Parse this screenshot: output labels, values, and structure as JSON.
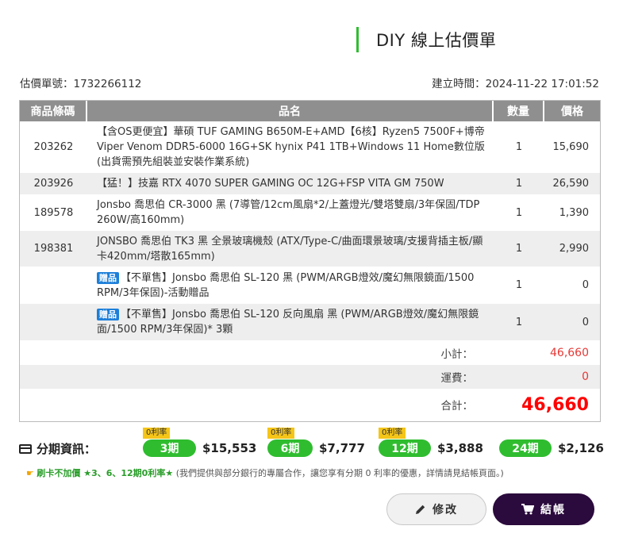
{
  "header": {
    "title": "DIY 線上估價單",
    "accent_color": "#2fbd2f"
  },
  "meta": {
    "quote_no_label": "估價單號：",
    "quote_no": "1732266112",
    "created_label": "建立時間：",
    "created_at": "2024-11-22 17:01:52"
  },
  "table": {
    "columns": [
      "商品條碼",
      "品名",
      "數量",
      "價格"
    ],
    "rows": [
      {
        "code": "203262",
        "gift": "",
        "name": "【含OS更便宜】華碩 TUF GAMING B650M-E+AMD【6核】Ryzen5 7500F+博帝 Viper Venom DDR5-6000 16G+SK hynix P41 1TB+Windows 11 Home數位版(出貨需預先組裝並安裝作業系統)",
        "qty": "1",
        "price": "15,690"
      },
      {
        "code": "203926",
        "gift": "",
        "name": "【猛！】技嘉 RTX 4070 SUPER GAMING OC 12G+FSP VITA GM 750W",
        "qty": "1",
        "price": "26,590"
      },
      {
        "code": "189578",
        "gift": "",
        "name": "Jonsbo 喬思伯 CR-3000 黑 (7導管/12cm風扇*2/上蓋燈光/雙塔雙扇/3年保固/TDP 260W/高160mm)",
        "qty": "1",
        "price": "1,390"
      },
      {
        "code": "198381",
        "gift": "",
        "name": "JONSBO 喬思伯 TK3 黑 全景玻璃機殼 (ATX/Type-C/曲面環景玻璃/支援背插主板/顯卡420mm/塔散165mm)",
        "qty": "1",
        "price": "2,990"
      },
      {
        "code": "",
        "gift": "贈品",
        "name": "【不單售】Jonsbo 喬思伯 SL-120 黑 (PWM/ARGB燈效/魔幻無限鏡面/1500 RPM/3年保固)-活動贈品",
        "qty": "1",
        "price": "0"
      },
      {
        "code": "",
        "gift": "贈品",
        "name": "【不單售】Jonsbo 喬思伯 SL-120 反向風扇 黑 (PWM/ARGB燈效/魔幻無限鏡面/1500 RPM/3年保固)* 3顆",
        "qty": "1",
        "price": "0"
      }
    ]
  },
  "summary": {
    "subtotal_label": "小計：",
    "subtotal": "46,660",
    "shipping_label": "運費：",
    "shipping": "0",
    "total_label": "合計：",
    "total": "46,660"
  },
  "installment": {
    "label": "分期資訊：",
    "plans": [
      {
        "tag": "0利率",
        "period": "3期",
        "amount": "$15,553"
      },
      {
        "tag": "0利率",
        "period": "6期",
        "amount": "$7,777"
      },
      {
        "tag": "0利率",
        "period": "12期",
        "amount": "$3,888"
      },
      {
        "tag": "",
        "period": "24期",
        "amount": "$2,126"
      }
    ],
    "note_highlight": "刷卡不加價 ★3、6、12期0利率★",
    "note_rest": "(我們提供與部分銀行的專屬合作，讓您享有分期 0 利率的優惠，詳情請見結帳頁面。)"
  },
  "buttons": {
    "edit_label": "修改",
    "checkout_label": "結帳"
  },
  "icons": {
    "card": "credit-card-icon",
    "hand": "pointing-hand-icon",
    "pencil": "pencil-icon",
    "cart": "cart-icon"
  }
}
